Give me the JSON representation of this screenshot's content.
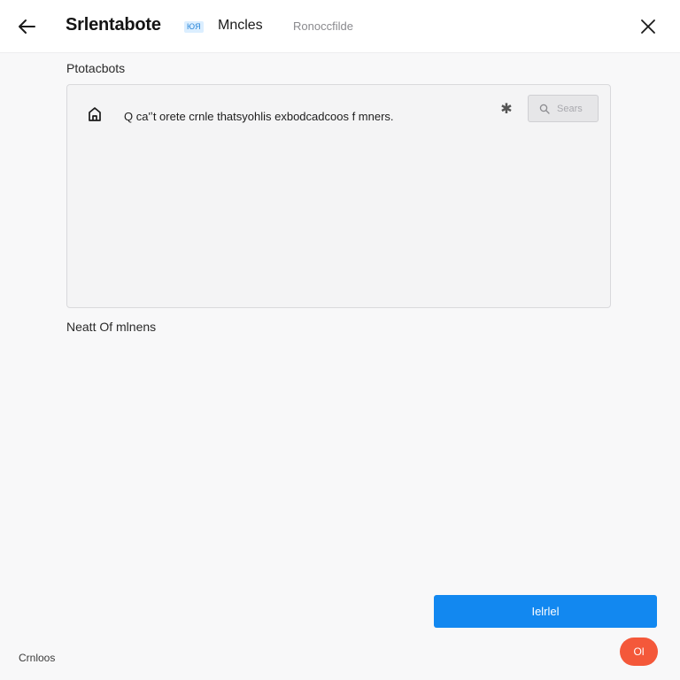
{
  "header": {
    "back_icon": "arrow-left-icon",
    "title": "Srlentabote",
    "badge": "ЮЯ",
    "tab_active": "Mncles",
    "tab_secondary": "Ronoccfilde",
    "close_icon": "close-icon"
  },
  "section1": {
    "label": "Ptotacbots",
    "item": {
      "icon": "home-icon",
      "text": "Q  ca'ʼt  orete  crnle  thatsyohlis  exbodcadcoos  f  mners.",
      "star_icon": "star-icon",
      "star_glyph": "✱"
    },
    "search": {
      "icon": "search-icon",
      "placeholder": "Sears"
    }
  },
  "section2": {
    "label": "Neatt  Of  mlnens"
  },
  "actions": {
    "primary_label": "Ielrlel",
    "footer_link": "Crnloos",
    "ok_label": "Ol"
  },
  "colors": {
    "accent": "#1288f0",
    "danger": "#f4583a",
    "badge_bg": "#dbeeff"
  }
}
